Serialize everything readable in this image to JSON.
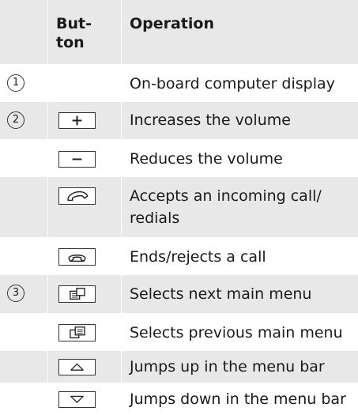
{
  "header": {
    "button": "But-\nton",
    "operation": "Operation"
  },
  "rows": [
    {
      "num": "1",
      "icon": "",
      "text": "On-board computer display"
    },
    {
      "num": "2",
      "icon": "plus-icon",
      "text": "Increases the volume"
    },
    {
      "num": "",
      "icon": "minus-icon",
      "text": "Reduces the volume"
    },
    {
      "num": "",
      "icon": "phone-accept-icon",
      "text": "Accepts an incoming call/\nredials"
    },
    {
      "num": "",
      "icon": "phone-hangup-icon",
      "text": "Ends/rejects a call"
    },
    {
      "num": "3",
      "icon": "menu-next-icon",
      "text": "Selects next main menu"
    },
    {
      "num": "",
      "icon": "menu-previous-icon",
      "text": "Selects previous main menu"
    },
    {
      "num": "",
      "icon": "arrow-up-icon",
      "text": "Jumps up in the menu bar"
    },
    {
      "num": "",
      "icon": "arrow-down-icon",
      "text": "Jumps down in the menu bar"
    }
  ]
}
